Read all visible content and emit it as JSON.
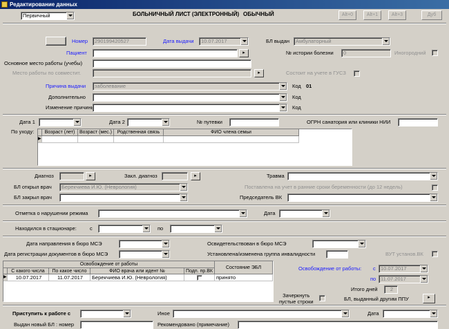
{
  "window": {
    "title": "Редактирование данных"
  },
  "toolbar": {
    "type_select": "Первичный",
    "header": "БОЛЬНИЧНЫЙ ЛИСТ (ЭЛЕКТРОННЫЙ)",
    "header_type": "ОБЫЧНЫЙ",
    "buttons": [
      "Alt+0",
      "Alt+1",
      "Alt+3",
      "Дуб"
    ]
  },
  "top": {
    "number_label": "Номер",
    "number_value": "290199420527",
    "issue_date_label": "Дата выдачи",
    "issue_date_value": "10.07.2017",
    "bl_issued_label": "БЛ выдан",
    "bl_issued_value": "Амбулаторный",
    "patient_label": "Пациент",
    "history_label": "№ истории болезни",
    "history_value": "0",
    "foreign_label": "Иногородний",
    "main_work_label": "Основное место работы (учебы)",
    "part_time_label": "Место работы по совместит.",
    "gusz_label": "Состоит на учете в ГУСЗ",
    "reason_label": "Причина выдачи",
    "reason_value": "заболевание",
    "code_label": "Код",
    "code_value": "01",
    "extra_label": "Дополнительно",
    "change_reason_label": "Изменение причины"
  },
  "care": {
    "date1_label": "Дата 1",
    "date2_label": "Дата 2",
    "voucher_label": "№ путевки",
    "ogrn_label": "ОГРН санатория или клиники НИИ",
    "care_label": "По уходу:",
    "columns": [
      "Возраст (лет)",
      "Возраст (мес.)",
      "Родственная связь",
      "ФИО члена семьи"
    ]
  },
  "diag": {
    "diagnosis_label": "Диагноз",
    "final_diag_label": "Закл. диагноз",
    "trauma_label": "Травма",
    "opened_doctor_label": "БЛ открыл врач",
    "opened_doctor_value": "Берекчиева И.Ю. (Неврология)",
    "pregnancy_label": "Поставлена на учет в ранние сроки беременности (до 12 недель)",
    "closed_doctor_label": "БЛ закрыл врач",
    "vk_chair_label": "Председатель ВК"
  },
  "violation": {
    "label": "Отметка о нарушении режима",
    "date_label": "Дата"
  },
  "hospital": {
    "label": "Находился в стационаре:",
    "from_label": "с",
    "to_label": "по"
  },
  "mse": {
    "referral_label": "Дата направления в бюро МСЭ",
    "registration_label": "Дата регистрации документов в бюро МСЭ",
    "examined_label": "Освидетельствован в бюро МСЭ",
    "disability_label": "Установлена/изменена группа инвалидности",
    "vut_label": "ВУТ установ.ВК"
  },
  "release": {
    "group_header": "Освобождение от работы",
    "columns": [
      "С какого числа",
      "По какое число",
      "ФИО врача или идент №",
      "Подп. пр.ВК"
    ],
    "state_header": "Состояние ЭБЛ",
    "rows": [
      {
        "from": "10.07.2017",
        "to": "11.07.2017",
        "doctor": "Берекчиева И.Ю. (Неврология)",
        "state": "принято"
      }
    ],
    "right_label": "Освобождение от работы:",
    "from_label": "с",
    "from_value": "10.07.2017",
    "to_label": "по",
    "to_value": "11.07.2017",
    "total_label": "Итого дней",
    "total_value": "2",
    "strike_label_1": "Зачеркнуть",
    "strike_label_2": "пустые строки",
    "other_ppu_label": "БЛ, выданный другим ППУ"
  },
  "bottom": {
    "start_work_label": "Приступить к работе с",
    "other_label": "Иное",
    "date_label": "Дата",
    "new_bl_label": "Выдан новый БЛ : номер",
    "recommend_label": "Рекомендовано (примечание)"
  }
}
